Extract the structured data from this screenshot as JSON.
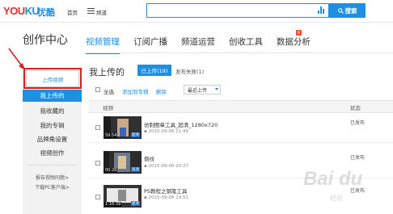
{
  "header": {
    "logo_text": "YOU",
    "logo_text2": "KU",
    "logo_cn": "优酷",
    "nav_home": "首页",
    "nav_channel": "频道",
    "search_button": "搜索",
    "brand_colors": {
      "red": "#e62e2e",
      "blue": "#1e8fe1"
    }
  },
  "page": {
    "title": "创作中心",
    "tabs": [
      {
        "label": "视频管理",
        "active": true
      },
      {
        "label": "订阅广播",
        "active": false
      },
      {
        "label": "频道运营",
        "active": false
      },
      {
        "label": "创收工具",
        "active": false
      },
      {
        "label": "数据分析",
        "active": false
      }
    ],
    "data_tab_badge": "8"
  },
  "sidebar": {
    "upload_button": "上传视频",
    "items": [
      {
        "label": "我上传的",
        "active": true
      },
      {
        "label": "我收藏的",
        "active": false
      },
      {
        "label": "我的专辑",
        "active": false
      },
      {
        "label": "品牌角设置",
        "active": false
      },
      {
        "label": "视频创作",
        "active": false
      }
    ],
    "link_report": "报告视频问题>",
    "link_download": "下载PC客户端>"
  },
  "main": {
    "section_title": "我上传的",
    "uploaded_pill": "已上传(19)",
    "failed_label": "发布失败(1)",
    "toolbar": {
      "select_all": "全选",
      "add_to_album": "添加到专辑",
      "delete": "删除",
      "sort_value": "最近上传"
    },
    "table_headers": {
      "video": "视频",
      "status": "状态"
    },
    "rows": [
      {
        "title": "仿制图章工具_超清_1280x720",
        "date": "2015-09-06 21:49",
        "duration": "59:54",
        "tag": "超清",
        "status": "已发布"
      },
      {
        "title": "倒纹",
        "date": "2015-09-06 20:27",
        "duration": "00:20",
        "tag": "高清",
        "status": "已发布"
      },
      {
        "title": "PS教程之钢笔工具",
        "date": "2015-09-06 19:51",
        "duration": "1:16:39",
        "tag": "超清",
        "status": "已发布"
      }
    ]
  },
  "watermark": {
    "text": "Bai du",
    "sub": "经验"
  }
}
